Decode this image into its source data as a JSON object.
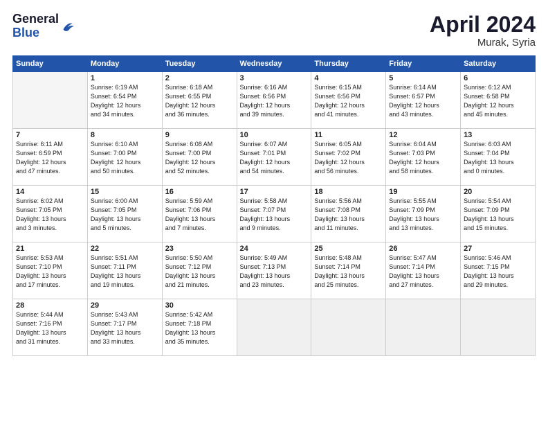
{
  "header": {
    "logo_line1": "General",
    "logo_line2": "Blue",
    "month_year": "April 2024",
    "location": "Murak, Syria"
  },
  "weekdays": [
    "Sunday",
    "Monday",
    "Tuesday",
    "Wednesday",
    "Thursday",
    "Friday",
    "Saturday"
  ],
  "weeks": [
    [
      {
        "day": "",
        "info": ""
      },
      {
        "day": "1",
        "info": "Sunrise: 6:19 AM\nSunset: 6:54 PM\nDaylight: 12 hours\nand 34 minutes."
      },
      {
        "day": "2",
        "info": "Sunrise: 6:18 AM\nSunset: 6:55 PM\nDaylight: 12 hours\nand 36 minutes."
      },
      {
        "day": "3",
        "info": "Sunrise: 6:16 AM\nSunset: 6:56 PM\nDaylight: 12 hours\nand 39 minutes."
      },
      {
        "day": "4",
        "info": "Sunrise: 6:15 AM\nSunset: 6:56 PM\nDaylight: 12 hours\nand 41 minutes."
      },
      {
        "day": "5",
        "info": "Sunrise: 6:14 AM\nSunset: 6:57 PM\nDaylight: 12 hours\nand 43 minutes."
      },
      {
        "day": "6",
        "info": "Sunrise: 6:12 AM\nSunset: 6:58 PM\nDaylight: 12 hours\nand 45 minutes."
      }
    ],
    [
      {
        "day": "7",
        "info": "Sunrise: 6:11 AM\nSunset: 6:59 PM\nDaylight: 12 hours\nand 47 minutes."
      },
      {
        "day": "8",
        "info": "Sunrise: 6:10 AM\nSunset: 7:00 PM\nDaylight: 12 hours\nand 50 minutes."
      },
      {
        "day": "9",
        "info": "Sunrise: 6:08 AM\nSunset: 7:00 PM\nDaylight: 12 hours\nand 52 minutes."
      },
      {
        "day": "10",
        "info": "Sunrise: 6:07 AM\nSunset: 7:01 PM\nDaylight: 12 hours\nand 54 minutes."
      },
      {
        "day": "11",
        "info": "Sunrise: 6:05 AM\nSunset: 7:02 PM\nDaylight: 12 hours\nand 56 minutes."
      },
      {
        "day": "12",
        "info": "Sunrise: 6:04 AM\nSunset: 7:03 PM\nDaylight: 12 hours\nand 58 minutes."
      },
      {
        "day": "13",
        "info": "Sunrise: 6:03 AM\nSunset: 7:04 PM\nDaylight: 13 hours\nand 0 minutes."
      }
    ],
    [
      {
        "day": "14",
        "info": "Sunrise: 6:02 AM\nSunset: 7:05 PM\nDaylight: 13 hours\nand 3 minutes."
      },
      {
        "day": "15",
        "info": "Sunrise: 6:00 AM\nSunset: 7:05 PM\nDaylight: 13 hours\nand 5 minutes."
      },
      {
        "day": "16",
        "info": "Sunrise: 5:59 AM\nSunset: 7:06 PM\nDaylight: 13 hours\nand 7 minutes."
      },
      {
        "day": "17",
        "info": "Sunrise: 5:58 AM\nSunset: 7:07 PM\nDaylight: 13 hours\nand 9 minutes."
      },
      {
        "day": "18",
        "info": "Sunrise: 5:56 AM\nSunset: 7:08 PM\nDaylight: 13 hours\nand 11 minutes."
      },
      {
        "day": "19",
        "info": "Sunrise: 5:55 AM\nSunset: 7:09 PM\nDaylight: 13 hours\nand 13 minutes."
      },
      {
        "day": "20",
        "info": "Sunrise: 5:54 AM\nSunset: 7:09 PM\nDaylight: 13 hours\nand 15 minutes."
      }
    ],
    [
      {
        "day": "21",
        "info": "Sunrise: 5:53 AM\nSunset: 7:10 PM\nDaylight: 13 hours\nand 17 minutes."
      },
      {
        "day": "22",
        "info": "Sunrise: 5:51 AM\nSunset: 7:11 PM\nDaylight: 13 hours\nand 19 minutes."
      },
      {
        "day": "23",
        "info": "Sunrise: 5:50 AM\nSunset: 7:12 PM\nDaylight: 13 hours\nand 21 minutes."
      },
      {
        "day": "24",
        "info": "Sunrise: 5:49 AM\nSunset: 7:13 PM\nDaylight: 13 hours\nand 23 minutes."
      },
      {
        "day": "25",
        "info": "Sunrise: 5:48 AM\nSunset: 7:14 PM\nDaylight: 13 hours\nand 25 minutes."
      },
      {
        "day": "26",
        "info": "Sunrise: 5:47 AM\nSunset: 7:14 PM\nDaylight: 13 hours\nand 27 minutes."
      },
      {
        "day": "27",
        "info": "Sunrise: 5:46 AM\nSunset: 7:15 PM\nDaylight: 13 hours\nand 29 minutes."
      }
    ],
    [
      {
        "day": "28",
        "info": "Sunrise: 5:44 AM\nSunset: 7:16 PM\nDaylight: 13 hours\nand 31 minutes."
      },
      {
        "day": "29",
        "info": "Sunrise: 5:43 AM\nSunset: 7:17 PM\nDaylight: 13 hours\nand 33 minutes."
      },
      {
        "day": "30",
        "info": "Sunrise: 5:42 AM\nSunset: 7:18 PM\nDaylight: 13 hours\nand 35 minutes."
      },
      {
        "day": "",
        "info": ""
      },
      {
        "day": "",
        "info": ""
      },
      {
        "day": "",
        "info": ""
      },
      {
        "day": "",
        "info": ""
      }
    ]
  ]
}
